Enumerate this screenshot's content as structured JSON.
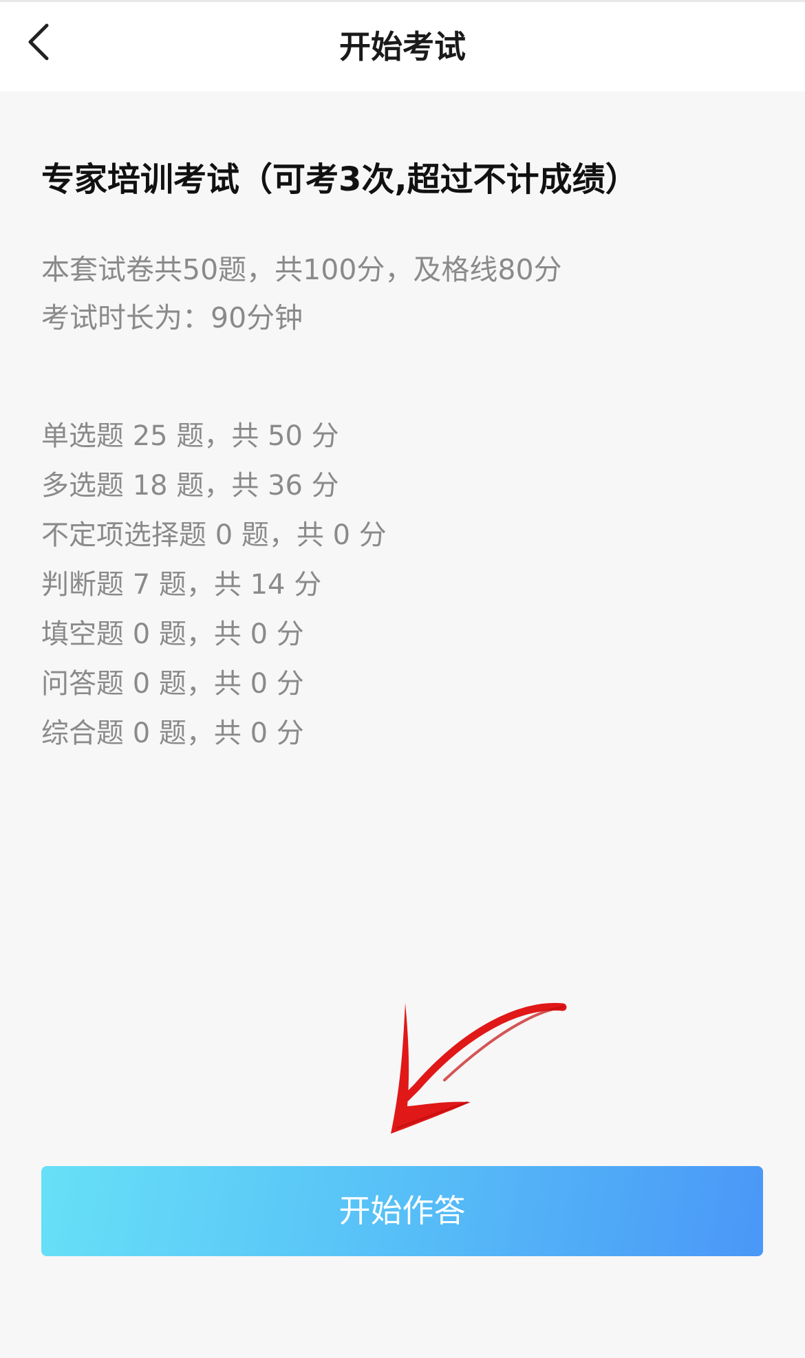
{
  "header": {
    "title": "开始考试",
    "back_icon": "chevron-left-icon"
  },
  "exam": {
    "title": "专家培训考试（可考3次,超过不计成绩）",
    "summary": "本套试卷共50题，共100分，及格线80分",
    "duration": "考试时长为：90分钟"
  },
  "breakdown": [
    "单选题 25 题，共 50 分",
    "多选题 18 题，共 36 分",
    "不定项选择题 0 题，共 0 分",
    "判断题 7 题，共 14 分",
    "填空题 0 题，共 0 分",
    "问答题 0 题，共 0 分",
    "综合题 0 题，共 0 分"
  ],
  "actions": {
    "start_label": "开始作答"
  },
  "colors": {
    "button_gradient_start": "#67e0f7",
    "button_gradient_end": "#4a97f7",
    "annotation_arrow": "#e01818"
  }
}
